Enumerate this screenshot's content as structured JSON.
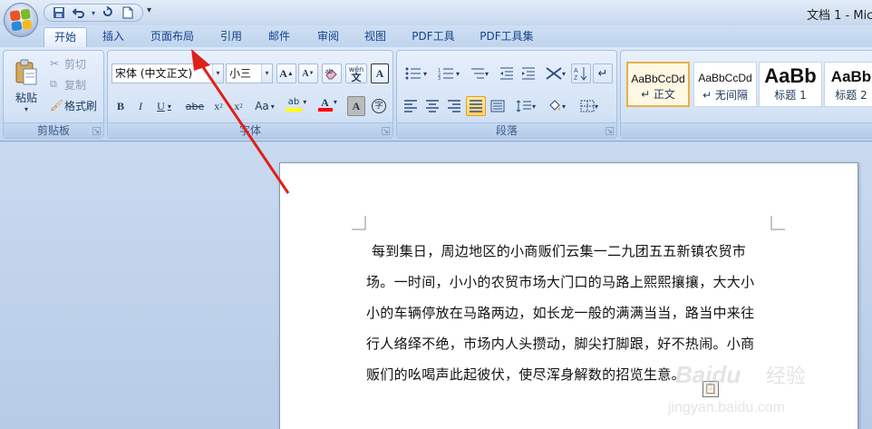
{
  "window": {
    "title": "文档 1 - Mic"
  },
  "quick_access": {
    "icons": [
      "save-icon",
      "undo-icon",
      "redo-icon",
      "new-document-icon"
    ],
    "more": "▾"
  },
  "tabs": [
    {
      "label": "开始",
      "active": true
    },
    {
      "label": "插入"
    },
    {
      "label": "页面布局"
    },
    {
      "label": "引用"
    },
    {
      "label": "邮件"
    },
    {
      "label": "审阅"
    },
    {
      "label": "视图"
    },
    {
      "label": "PDF工具"
    },
    {
      "label": "PDF工具集"
    }
  ],
  "clipboard": {
    "paste": "粘贴",
    "cut": "剪切",
    "copy": "复制",
    "format_painter": "格式刷",
    "group_label": "剪贴板"
  },
  "font": {
    "font_name": "宋体 (中文正文)",
    "font_size": "小三",
    "grow": "A",
    "shrink": "A",
    "clear_format_icon": "eraser-icon",
    "phonetic": "wén",
    "char_border": "A",
    "bold": "B",
    "italic": "I",
    "underline": "U",
    "strikethrough": "abe",
    "subscript": "x",
    "subscript_mark": "2",
    "superscript": "x",
    "superscript_mark": "2",
    "change_case": "Aa",
    "highlight": "ab",
    "font_color": "A",
    "char_shading": "A",
    "enclose": "字",
    "group_label": "字体"
  },
  "paragraph": {
    "group_label": "段落"
  },
  "styles": [
    {
      "sample": "AaBbCcDd",
      "label": "↵ 正文",
      "selected": true
    },
    {
      "sample": "AaBbCcDd",
      "label": "↵ 无间隔"
    },
    {
      "sample": "AaBb",
      "label": "标题 1"
    },
    {
      "sample": "AaBb",
      "label": "标题 2"
    }
  ],
  "document": {
    "lines": [
      "每到集日，周边地区的小商贩们云集一二九团五五新镇农贸市",
      "场。一时间，小小的农贸市场大门口的马路上熙熙攘攘，大大小",
      "小的车辆停放在马路两边，如长龙一般的满满当当，路当中来往",
      "行人络绎不绝，市场内人头攒动，脚尖打脚跟，好不热闹。小商",
      "贩们的吆喝声此起彼伏，使尽浑身解数的招览生意。"
    ]
  },
  "watermark": {
    "brand": "Baidu",
    "brand_cn": "经验",
    "url": "jingyan.baidu.com"
  },
  "colors": {
    "highlight": "#ffff00",
    "font_color": "#ff0000",
    "annotation_arrow": "#e0201b"
  }
}
